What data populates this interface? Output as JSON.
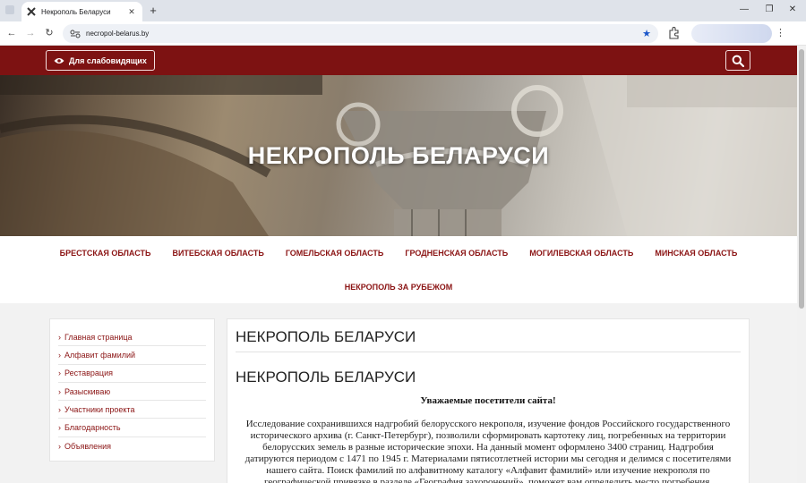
{
  "browser": {
    "tab_title": "Некрополь Беларуси",
    "url": "necropol-belarus.by"
  },
  "topbar": {
    "vision_label": "Для слабовидящих"
  },
  "hero": {
    "title": "НЕКРОПОЛЬ БЕЛАРУСИ"
  },
  "regions": [
    "БРЕСТСКАЯ ОБЛАСТЬ",
    "ВИТЕБСКАЯ ОБЛАСТЬ",
    "ГОМЕЛЬСКАЯ ОБЛАСТЬ",
    "ГРОДНЕНСКАЯ ОБЛАСТЬ",
    "МОГИЛЕВСКАЯ ОБЛАСТЬ",
    "МИНСКАЯ ОБЛАСТЬ",
    "НЕКРОПОЛЬ ЗА РУБЕЖОМ"
  ],
  "sidebar": {
    "items": [
      "Главная страница",
      "Алфавит фамилий",
      "Реставрация",
      "Разыскиваю",
      "Участники проекта",
      "Благодарность",
      "Объявления"
    ]
  },
  "content": {
    "heading": "НЕКРОПОЛЬ БЕЛАРУСИ",
    "subheading": "НЕКРОПОЛЬ БЕЛАРУСИ",
    "greeting": "Уважаемые посетители сайта!",
    "body": "Исследование сохранившихся надгробий белорусского некрополя, изучение фондов Российского государственного исторического архива (г. Санкт-Петербург), позволили сформировать картотеку лиц, погребенных на территории белорусских земель в разные исторические эпохи. На данный момент оформлено 3400 страниц. Надгробия датируются периодом с 1471 по 1945 г. Материалами пятисотлетней истории мы сегодня и делимся с посетителями нашего сайта. Поиск фамилий по алфавитному каталогу «Алфавит фамилий» или изучение некрополя по географической привязке в разделе «География захоронений», поможет вам определить место погребения, родственные связи многих исторических"
  },
  "colors": {
    "brand": "#7d1212",
    "link": "#8b1414"
  }
}
